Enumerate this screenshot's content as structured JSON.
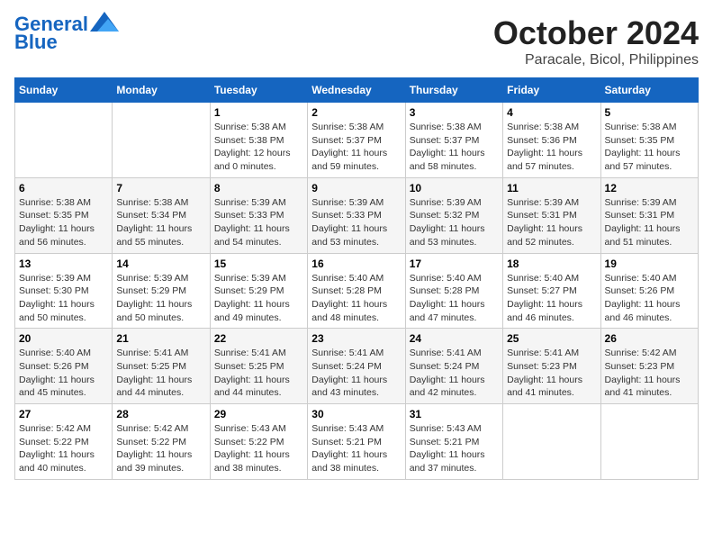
{
  "logo": {
    "line1": "General",
    "line2": "Blue"
  },
  "title": "October 2024",
  "subtitle": "Paracale, Bicol, Philippines",
  "days_of_week": [
    "Sunday",
    "Monday",
    "Tuesday",
    "Wednesday",
    "Thursday",
    "Friday",
    "Saturday"
  ],
  "weeks": [
    [
      {
        "day": "",
        "info": ""
      },
      {
        "day": "",
        "info": ""
      },
      {
        "day": "1",
        "info": "Sunrise: 5:38 AM\nSunset: 5:38 PM\nDaylight: 12 hours and 0 minutes."
      },
      {
        "day": "2",
        "info": "Sunrise: 5:38 AM\nSunset: 5:37 PM\nDaylight: 11 hours and 59 minutes."
      },
      {
        "day": "3",
        "info": "Sunrise: 5:38 AM\nSunset: 5:37 PM\nDaylight: 11 hours and 58 minutes."
      },
      {
        "day": "4",
        "info": "Sunrise: 5:38 AM\nSunset: 5:36 PM\nDaylight: 11 hours and 57 minutes."
      },
      {
        "day": "5",
        "info": "Sunrise: 5:38 AM\nSunset: 5:35 PM\nDaylight: 11 hours and 57 minutes."
      }
    ],
    [
      {
        "day": "6",
        "info": "Sunrise: 5:38 AM\nSunset: 5:35 PM\nDaylight: 11 hours and 56 minutes."
      },
      {
        "day": "7",
        "info": "Sunrise: 5:38 AM\nSunset: 5:34 PM\nDaylight: 11 hours and 55 minutes."
      },
      {
        "day": "8",
        "info": "Sunrise: 5:39 AM\nSunset: 5:33 PM\nDaylight: 11 hours and 54 minutes."
      },
      {
        "day": "9",
        "info": "Sunrise: 5:39 AM\nSunset: 5:33 PM\nDaylight: 11 hours and 53 minutes."
      },
      {
        "day": "10",
        "info": "Sunrise: 5:39 AM\nSunset: 5:32 PM\nDaylight: 11 hours and 53 minutes."
      },
      {
        "day": "11",
        "info": "Sunrise: 5:39 AM\nSunset: 5:31 PM\nDaylight: 11 hours and 52 minutes."
      },
      {
        "day": "12",
        "info": "Sunrise: 5:39 AM\nSunset: 5:31 PM\nDaylight: 11 hours and 51 minutes."
      }
    ],
    [
      {
        "day": "13",
        "info": "Sunrise: 5:39 AM\nSunset: 5:30 PM\nDaylight: 11 hours and 50 minutes."
      },
      {
        "day": "14",
        "info": "Sunrise: 5:39 AM\nSunset: 5:29 PM\nDaylight: 11 hours and 50 minutes."
      },
      {
        "day": "15",
        "info": "Sunrise: 5:39 AM\nSunset: 5:29 PM\nDaylight: 11 hours and 49 minutes."
      },
      {
        "day": "16",
        "info": "Sunrise: 5:40 AM\nSunset: 5:28 PM\nDaylight: 11 hours and 48 minutes."
      },
      {
        "day": "17",
        "info": "Sunrise: 5:40 AM\nSunset: 5:28 PM\nDaylight: 11 hours and 47 minutes."
      },
      {
        "day": "18",
        "info": "Sunrise: 5:40 AM\nSunset: 5:27 PM\nDaylight: 11 hours and 46 minutes."
      },
      {
        "day": "19",
        "info": "Sunrise: 5:40 AM\nSunset: 5:26 PM\nDaylight: 11 hours and 46 minutes."
      }
    ],
    [
      {
        "day": "20",
        "info": "Sunrise: 5:40 AM\nSunset: 5:26 PM\nDaylight: 11 hours and 45 minutes."
      },
      {
        "day": "21",
        "info": "Sunrise: 5:41 AM\nSunset: 5:25 PM\nDaylight: 11 hours and 44 minutes."
      },
      {
        "day": "22",
        "info": "Sunrise: 5:41 AM\nSunset: 5:25 PM\nDaylight: 11 hours and 44 minutes."
      },
      {
        "day": "23",
        "info": "Sunrise: 5:41 AM\nSunset: 5:24 PM\nDaylight: 11 hours and 43 minutes."
      },
      {
        "day": "24",
        "info": "Sunrise: 5:41 AM\nSunset: 5:24 PM\nDaylight: 11 hours and 42 minutes."
      },
      {
        "day": "25",
        "info": "Sunrise: 5:41 AM\nSunset: 5:23 PM\nDaylight: 11 hours and 41 minutes."
      },
      {
        "day": "26",
        "info": "Sunrise: 5:42 AM\nSunset: 5:23 PM\nDaylight: 11 hours and 41 minutes."
      }
    ],
    [
      {
        "day": "27",
        "info": "Sunrise: 5:42 AM\nSunset: 5:22 PM\nDaylight: 11 hours and 40 minutes."
      },
      {
        "day": "28",
        "info": "Sunrise: 5:42 AM\nSunset: 5:22 PM\nDaylight: 11 hours and 39 minutes."
      },
      {
        "day": "29",
        "info": "Sunrise: 5:43 AM\nSunset: 5:22 PM\nDaylight: 11 hours and 38 minutes."
      },
      {
        "day": "30",
        "info": "Sunrise: 5:43 AM\nSunset: 5:21 PM\nDaylight: 11 hours and 38 minutes."
      },
      {
        "day": "31",
        "info": "Sunrise: 5:43 AM\nSunset: 5:21 PM\nDaylight: 11 hours and 37 minutes."
      },
      {
        "day": "",
        "info": ""
      },
      {
        "day": "",
        "info": ""
      }
    ]
  ]
}
